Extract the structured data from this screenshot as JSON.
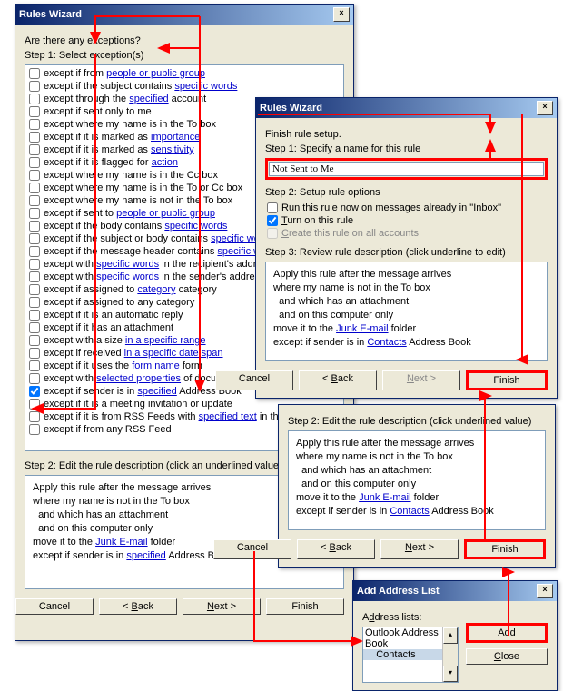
{
  "dialog1": {
    "title": "Rules Wizard",
    "q": "Are there any exceptions?",
    "step1": "Step 1: Select exception(s)",
    "exceptions": [
      {
        "checked": false,
        "pre": "except if from ",
        "link": "people or public group",
        "post": ""
      },
      {
        "checked": false,
        "pre": "except if the subject contains ",
        "link": "specific words",
        "post": ""
      },
      {
        "checked": false,
        "pre": "except through the ",
        "link": "specified",
        "post": " account"
      },
      {
        "checked": false,
        "pre": "except if sent only to me",
        "link": "",
        "post": ""
      },
      {
        "checked": false,
        "pre": "except where my name is in the To box",
        "link": "",
        "post": ""
      },
      {
        "checked": false,
        "pre": "except if it is marked as ",
        "link": "importance",
        "post": ""
      },
      {
        "checked": false,
        "pre": "except if it is marked as ",
        "link": "sensitivity",
        "post": ""
      },
      {
        "checked": false,
        "pre": "except if it is flagged for ",
        "link": "action",
        "post": ""
      },
      {
        "checked": false,
        "pre": "except where my name is in the Cc box",
        "link": "",
        "post": ""
      },
      {
        "checked": false,
        "pre": "except where my name is in the To or Cc box",
        "link": "",
        "post": ""
      },
      {
        "checked": false,
        "pre": "except where my name is not in the To box",
        "link": "",
        "post": ""
      },
      {
        "checked": false,
        "pre": "except if sent to ",
        "link": "people or public group",
        "post": ""
      },
      {
        "checked": false,
        "pre": "except if the body contains ",
        "link": "specific words",
        "post": ""
      },
      {
        "checked": false,
        "pre": "except if the subject or body contains ",
        "link": "specific words",
        "post": ""
      },
      {
        "checked": false,
        "pre": "except if the message header contains ",
        "link": "specific words",
        "post": ""
      },
      {
        "checked": false,
        "pre": "except with ",
        "link": "specific words",
        "post": " in the recipient's address"
      },
      {
        "checked": false,
        "pre": "except with ",
        "link": "specific words",
        "post": " in the sender's address"
      },
      {
        "checked": false,
        "pre": "except if assigned to ",
        "link": "category",
        "post": " category"
      },
      {
        "checked": false,
        "pre": "except if assigned to any category",
        "link": "",
        "post": ""
      },
      {
        "checked": false,
        "pre": "except if it is an automatic reply",
        "link": "",
        "post": ""
      },
      {
        "checked": false,
        "pre": "except if it has an attachment",
        "link": "",
        "post": ""
      },
      {
        "checked": false,
        "pre": "except with a size ",
        "link": "in a specific range",
        "post": ""
      },
      {
        "checked": false,
        "pre": "except if received ",
        "link": "in a specific date span",
        "post": ""
      },
      {
        "checked": false,
        "pre": "except if it uses the ",
        "link": "form name",
        "post": " form"
      },
      {
        "checked": false,
        "pre": "except with ",
        "link": "selected properties",
        "post": " of documents or forms"
      },
      {
        "checked": true,
        "pre": "except if sender is in ",
        "link": "specified",
        "post": " Address Book"
      },
      {
        "checked": false,
        "pre": "except if it is a meeting invitation or update",
        "link": "",
        "post": ""
      },
      {
        "checked": false,
        "pre": "except if it is from RSS Feeds with ",
        "link": "specified text",
        "post": " in the title"
      },
      {
        "checked": false,
        "pre": "except if from any RSS Feed",
        "link": "",
        "post": ""
      }
    ],
    "step2": "Step 2: Edit the rule description (click an underlined value)",
    "desc": {
      "l1": "Apply this rule after the message arrives",
      "l2": "where my name is not in the To box",
      "l3": "  and which has an attachment",
      "l4": "  and on this computer only",
      "l5a": "move it to the ",
      "l5link": "Junk E-mail",
      "l5b": " folder",
      "l6a": "except if sender is in ",
      "l6link": "specified",
      "l6b": " Address Book"
    },
    "btn_cancel": "Cancel",
    "btn_back": "< Back",
    "btn_next": "Next >",
    "btn_finish": "Finish"
  },
  "dialog2": {
    "title": "Rules Wizard",
    "sub": "Finish rule setup.",
    "step1": "Step 1: Specify a name for this rule",
    "name_value": "Not Sent to Me",
    "step2": "Step 2: Setup rule options",
    "opt1": "Run this rule now on messages already in \"Inbox\"",
    "opt2": "Turn on this rule",
    "opt3": "Create this rule on all accounts",
    "step3": "Step 3: Review rule description (click underline to edit)",
    "desc": {
      "l1": "Apply this rule after the message arrives",
      "l2": "where my name is not in the To box",
      "l3": "  and which has an attachment",
      "l4": "  and on this computer only",
      "l5a": "move it to the ",
      "l5link": "Junk E-mail",
      "l5b": " folder",
      "l6a": "except if sender is in ",
      "l6link": "Contacts",
      "l6b": " Address Book"
    },
    "btn_cancel": "Cancel",
    "btn_back": "< Back",
    "btn_next": "Next >",
    "btn_finish": "Finish"
  },
  "dialog3": {
    "step2": "Step 2: Edit the rule description (click underlined value)",
    "desc": {
      "l1": "Apply this rule after the message arrives",
      "l2": "where my name is not in the To box",
      "l3": "  and which has an attachment",
      "l4": "  and on this computer only",
      "l5a": "move it to the ",
      "l5link": "Junk E-mail",
      "l5b": " folder",
      "l6a": "except if sender is in ",
      "l6link": "Contacts",
      "l6b": " Address Book"
    },
    "btn_cancel": "Cancel",
    "btn_back": "< Back",
    "btn_next": "Next >",
    "btn_finish": "Finish"
  },
  "dialog4": {
    "title": "Add Address List",
    "label": "Address lists:",
    "items": [
      "Outlook Address Book",
      "    Contacts"
    ],
    "btn_add": "Add",
    "btn_close": "Close"
  }
}
